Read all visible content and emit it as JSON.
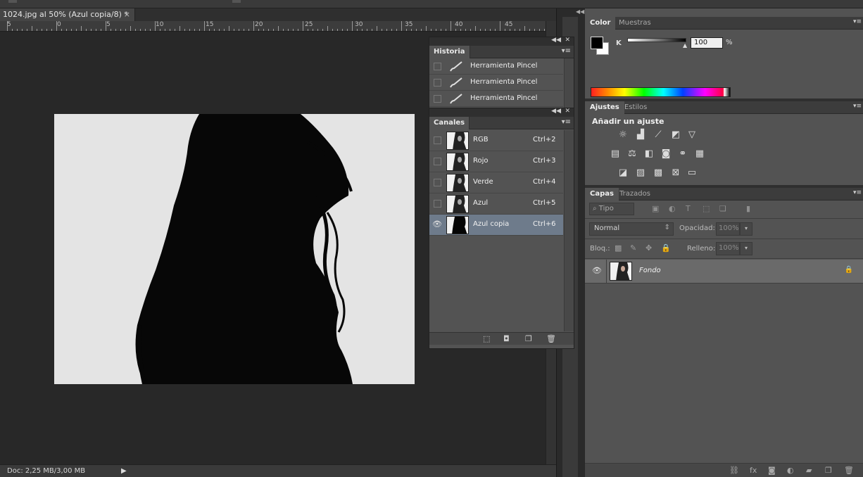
{
  "document": {
    "tab_title": "1024.jpg al 50% (Azul copia/8) *",
    "close_glyph": "×",
    "status": "Doc: 2,25 MB/3,00 MB",
    "ruler_labels": [
      "5",
      "0",
      "5",
      "10",
      "15",
      "20",
      "25",
      "30",
      "35",
      "40",
      "45"
    ]
  },
  "historia": {
    "tab": "Historia",
    "items": [
      {
        "label": "Herramienta Pincel",
        "icon": "brush-icon"
      },
      {
        "label": "Herramienta Pincel",
        "icon": "brush-icon"
      },
      {
        "label": "Herramienta Pincel",
        "icon": "brush-icon"
      }
    ]
  },
  "canales": {
    "tab": "Canales",
    "items": [
      {
        "name": "RGB",
        "shortcut": "Ctrl+2",
        "visible": false,
        "selected": false
      },
      {
        "name": "Rojo",
        "shortcut": "Ctrl+3",
        "visible": false,
        "selected": false
      },
      {
        "name": "Verde",
        "shortcut": "Ctrl+4",
        "visible": false,
        "selected": false
      },
      {
        "name": "Azul",
        "shortcut": "Ctrl+5",
        "visible": false,
        "selected": false
      },
      {
        "name": "Azul copia",
        "shortcut": "Ctrl+6",
        "visible": true,
        "selected": true
      }
    ]
  },
  "color_panel": {
    "tabs": [
      "Color",
      "Muestras"
    ],
    "active_tab": "Color",
    "channel_label": "K",
    "k_value": "100",
    "unit": "%",
    "foreground": "#000000",
    "background": "#ffffff"
  },
  "ajustes_panel": {
    "tabs": [
      "Ajustes",
      "Estilos"
    ],
    "active_tab": "Ajustes",
    "title": "Añadir un ajuste"
  },
  "capas_panel": {
    "tabs": [
      "Capas",
      "Trazados"
    ],
    "active_tab": "Capas",
    "filter_label": "Tipo",
    "blend_mode": "Normal",
    "opacity_label": "Opacidad:",
    "opacity_value": "100%",
    "lock_label": "Bloq.:",
    "fill_label": "Relleno:",
    "fill_value": "100%",
    "layers": [
      {
        "name": "Fondo",
        "visible": true,
        "locked": true
      }
    ]
  },
  "colors": {
    "selection": "#6e7b8b",
    "panel_bg": "#535353",
    "workspace": "#282828"
  }
}
